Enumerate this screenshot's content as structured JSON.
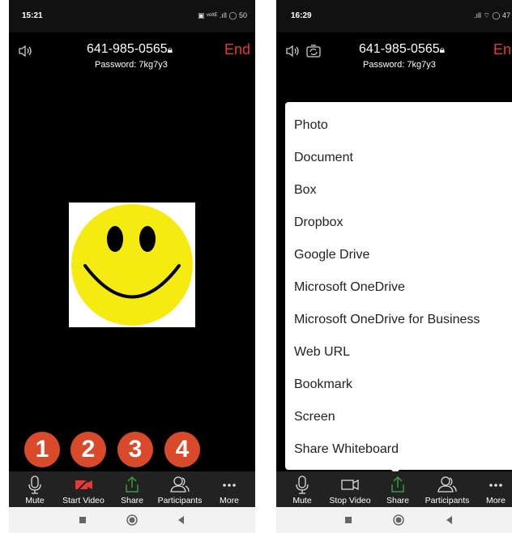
{
  "left_screen": {
    "status": {
      "time": "15:21",
      "icons": "▣ ᵛᵒˡᵗᴱ .ıll ◯ 50"
    },
    "header": {
      "meeting_id": "641-985-0565",
      "password": "Password: 7kg7y3",
      "end_label": "End"
    },
    "badges": [
      "1",
      "2",
      "3",
      "4"
    ],
    "toolbar": [
      {
        "label": "Mute",
        "icon": "microphone-icon"
      },
      {
        "label": "Start Video",
        "icon": "video-off-icon"
      },
      {
        "label": "Share",
        "icon": "share-icon"
      },
      {
        "label": "Participants",
        "icon": "participants-icon"
      },
      {
        "label": "More",
        "icon": "more-icon"
      }
    ]
  },
  "right_screen": {
    "status": {
      "time": "16:29",
      "icons": ".ıll ⌔ ◯ 47"
    },
    "header": {
      "meeting_id": "641-985-0565",
      "password": "Password: 7kg7y3",
      "end_label": "End"
    },
    "share_menu": [
      "Photo",
      "Document",
      "Box",
      "Dropbox",
      "Google Drive",
      "Microsoft OneDrive",
      "Microsoft OneDrive for Business",
      "Web URL",
      "Bookmark",
      "Screen",
      "Share Whiteboard"
    ],
    "toolbar": [
      {
        "label": "Mute",
        "icon": "microphone-icon"
      },
      {
        "label": "Stop Video",
        "icon": "video-icon"
      },
      {
        "label": "Share",
        "icon": "share-icon"
      },
      {
        "label": "Participants",
        "icon": "participants-icon"
      },
      {
        "label": "More",
        "icon": "more-icon"
      }
    ]
  },
  "colors": {
    "end_red": "#e53935",
    "share_green": "#2e9e3e",
    "badge_red": "#d94a2b",
    "video_off_red": "#e53935"
  }
}
